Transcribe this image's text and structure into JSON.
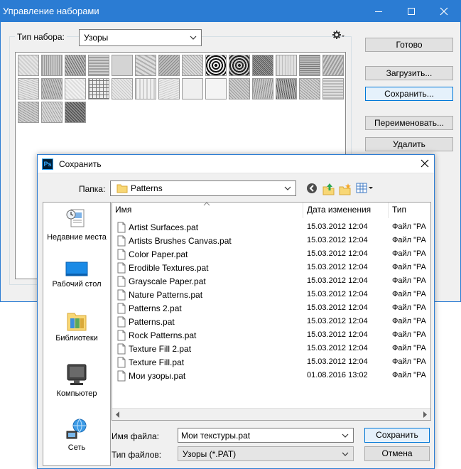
{
  "preset_manager": {
    "title": "Управление наборами",
    "preset_type_label": "Тип набора:",
    "preset_type_value": "Узоры",
    "buttons": {
      "done": "Готово",
      "load": "Загрузить...",
      "save": "Сохранить...",
      "rename": "Переименовать...",
      "delete": "Удалить"
    }
  },
  "save_dialog": {
    "title": "Сохранить",
    "folder_label": "Папка:",
    "folder_value": "Patterns",
    "columns": {
      "name": "Имя",
      "date": "Дата изменения",
      "type": "Тип"
    },
    "places": [
      {
        "label": "Недавние места",
        "icon": "recent-places-icon"
      },
      {
        "label": "Рабочий стол",
        "icon": "desktop-icon"
      },
      {
        "label": "Библиотеки",
        "icon": "libraries-icon"
      },
      {
        "label": "Компьютер",
        "icon": "computer-icon"
      },
      {
        "label": "Сеть",
        "icon": "network-icon"
      }
    ],
    "files": [
      {
        "name": "Artist Surfaces.pat",
        "date": "15.03.2012 12:04",
        "type": "Файл \"PA"
      },
      {
        "name": "Artists Brushes Canvas.pat",
        "date": "15.03.2012 12:04",
        "type": "Файл \"PA"
      },
      {
        "name": "Color Paper.pat",
        "date": "15.03.2012 12:04",
        "type": "Файл \"PA"
      },
      {
        "name": "Erodible Textures.pat",
        "date": "15.03.2012 12:04",
        "type": "Файл \"PA"
      },
      {
        "name": "Grayscale Paper.pat",
        "date": "15.03.2012 12:04",
        "type": "Файл \"PA"
      },
      {
        "name": "Nature Patterns.pat",
        "date": "15.03.2012 12:04",
        "type": "Файл \"PA"
      },
      {
        "name": "Patterns 2.pat",
        "date": "15.03.2012 12:04",
        "type": "Файл \"PA"
      },
      {
        "name": "Patterns.pat",
        "date": "15.03.2012 12:04",
        "type": "Файл \"PA"
      },
      {
        "name": "Rock Patterns.pat",
        "date": "15.03.2012 12:04",
        "type": "Файл \"PA"
      },
      {
        "name": "Texture Fill 2.pat",
        "date": "15.03.2012 12:04",
        "type": "Файл \"PA"
      },
      {
        "name": "Texture Fill.pat",
        "date": "15.03.2012 12:04",
        "type": "Файл \"PA"
      },
      {
        "name": "Мои узоры.pat",
        "date": "01.08.2016 13:02",
        "type": "Файл \"PA"
      }
    ],
    "filename_label": "Имя файла:",
    "filename_value": "Мои текстуры.pat",
    "filetype_label": "Тип файлов:",
    "filetype_value": "Узоры (*.PAT)",
    "save_button": "Сохранить",
    "cancel_button": "Отмена"
  },
  "colors": {
    "accent": "#2b7cd3",
    "selection": "#0078d7"
  }
}
